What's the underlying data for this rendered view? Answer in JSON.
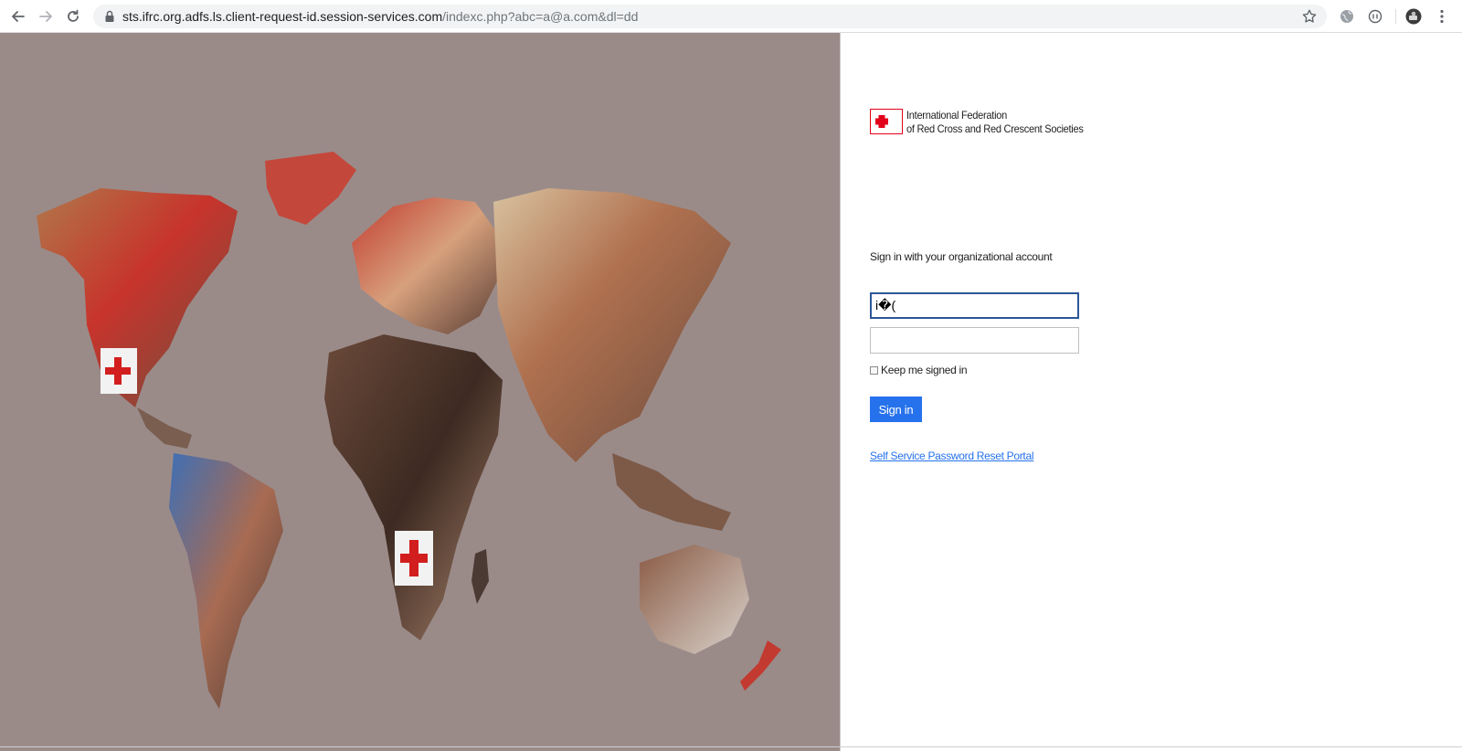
{
  "browser": {
    "url_host": "sts.ifrc.org.adfs.ls.client-request-id.session-services.com",
    "url_path": "/indexc.php?abc=a@a.com&dl=dd",
    "icons": [
      "back-arrow-icon",
      "forward-arrow-icon",
      "reload-icon",
      "lock-icon",
      "star-icon",
      "extension-globe-icon",
      "extension-circle-icon",
      "profile-avatar-icon",
      "menu-kebab-icon"
    ]
  },
  "logo": {
    "line1": "International Federation",
    "line2": "of Red Cross and Red Crescent Societies",
    "brand_color": "#e2001a"
  },
  "login": {
    "heading": "Sign in with your organizational account",
    "username_value": "i�(",
    "password_value": "",
    "keep_signed_in_label": "Keep me signed in",
    "keep_signed_in_checked": false,
    "sign_in_label": "Sign in",
    "reset_link_label": "Self Service Password Reset Portal"
  },
  "colors": {
    "accent": "#2672ec",
    "hero_background": "#9a8b89"
  }
}
